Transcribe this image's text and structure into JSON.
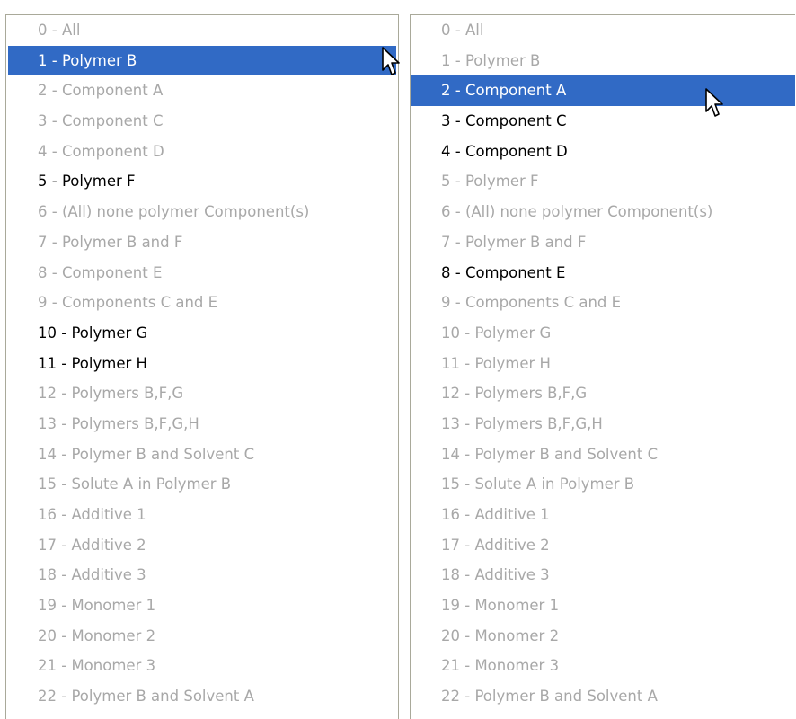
{
  "left_list": {
    "items": [
      {
        "label": "0 - All",
        "state": "disabled"
      },
      {
        "label": "1 - Polymer B",
        "state": "selected"
      },
      {
        "label": "2 - Component A",
        "state": "disabled"
      },
      {
        "label": "3 - Component C",
        "state": "disabled"
      },
      {
        "label": "4 - Component D",
        "state": "disabled"
      },
      {
        "label": "5 - Polymer F",
        "state": "enabled"
      },
      {
        "label": "6 - (All) none polymer Component(s)",
        "state": "disabled"
      },
      {
        "label": "7 - Polymer B and F",
        "state": "disabled"
      },
      {
        "label": "8 - Component E",
        "state": "disabled"
      },
      {
        "label": "9 - Components C and E",
        "state": "disabled"
      },
      {
        "label": "10 - Polymer G",
        "state": "enabled"
      },
      {
        "label": "11 - Polymer H",
        "state": "enabled"
      },
      {
        "label": "12 - Polymers B,F,G",
        "state": "disabled"
      },
      {
        "label": "13 - Polymers B,F,G,H",
        "state": "disabled"
      },
      {
        "label": "14 - Polymer B and Solvent C",
        "state": "disabled"
      },
      {
        "label": "15 - Solute A in Polymer B",
        "state": "disabled"
      },
      {
        "label": "16 - Additive 1",
        "state": "disabled"
      },
      {
        "label": "17 - Additive 2",
        "state": "disabled"
      },
      {
        "label": "18 - Additive 3",
        "state": "disabled"
      },
      {
        "label": "19 - Monomer 1",
        "state": "disabled"
      },
      {
        "label": "20 - Monomer 2",
        "state": "disabled"
      },
      {
        "label": "21 - Monomer 3",
        "state": "disabled"
      },
      {
        "label": "22 - Polymer B and Solvent A",
        "state": "disabled"
      }
    ]
  },
  "right_list": {
    "items": [
      {
        "label": "0 - All",
        "state": "disabled"
      },
      {
        "label": "1 - Polymer B",
        "state": "disabled"
      },
      {
        "label": "2 - Component A",
        "state": "selected"
      },
      {
        "label": "3 - Component C",
        "state": "enabled"
      },
      {
        "label": "4 - Component D",
        "state": "enabled"
      },
      {
        "label": "5 - Polymer F",
        "state": "disabled"
      },
      {
        "label": "6 - (All) none polymer Component(s)",
        "state": "disabled"
      },
      {
        "label": "7 - Polymer B and F",
        "state": "disabled"
      },
      {
        "label": "8 - Component E",
        "state": "enabled"
      },
      {
        "label": "9 - Components C and E",
        "state": "disabled"
      },
      {
        "label": "10 - Polymer G",
        "state": "disabled"
      },
      {
        "label": "11 - Polymer H",
        "state": "disabled"
      },
      {
        "label": "12 - Polymers B,F,G",
        "state": "disabled"
      },
      {
        "label": "13 - Polymers B,F,G,H",
        "state": "disabled"
      },
      {
        "label": "14 - Polymer B and Solvent C",
        "state": "disabled"
      },
      {
        "label": "15 - Solute A in Polymer B",
        "state": "disabled"
      },
      {
        "label": "16 - Additive 1",
        "state": "disabled"
      },
      {
        "label": "17 - Additive 2",
        "state": "disabled"
      },
      {
        "label": "18 - Additive 3",
        "state": "disabled"
      },
      {
        "label": "19 - Monomer 1",
        "state": "disabled"
      },
      {
        "label": "20 - Monomer 2",
        "state": "disabled"
      },
      {
        "label": "21 - Monomer 3",
        "state": "disabled"
      },
      {
        "label": "22 - Polymer B and Solvent A",
        "state": "disabled"
      }
    ]
  },
  "colors": {
    "selection": "#316ac5",
    "enabled_text": "#000000",
    "disabled_text": "#a8a8a8",
    "border": "#a9a99a"
  },
  "icons": {
    "cursor": "mouse-pointer-icon"
  }
}
